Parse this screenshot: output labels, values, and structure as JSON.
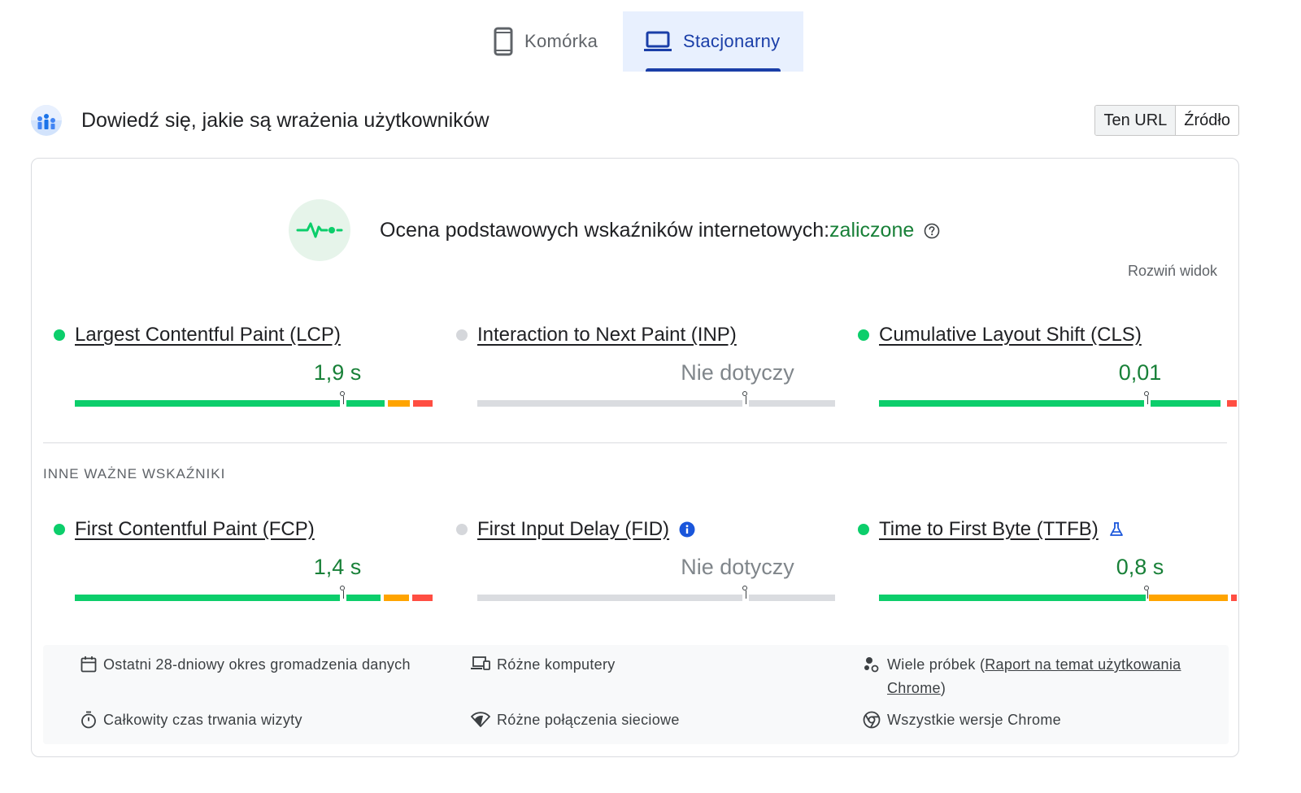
{
  "tabs": [
    {
      "label": "Komórka",
      "icon": "smartphone-icon",
      "active": false
    },
    {
      "label": "Stacjonarny",
      "icon": "laptop-icon",
      "active": true
    }
  ],
  "header": {
    "title": "Dowiedź się, jakie są wrażenia użytkowników",
    "toggle": {
      "url": "Ten URL",
      "origin": "Źródło",
      "active": "Ten URL"
    }
  },
  "assessment": {
    "label": "Ocena podstawowych wskaźników internetowych:",
    "result": "zaliczone",
    "expand": "Rozwiń widok"
  },
  "core_metrics": [
    {
      "name": "Largest Contentful Paint (LCP)",
      "status": "good",
      "value": "1,9 s",
      "distribution": {
        "good": 0.87,
        "needs_improvement": 0.07,
        "poor": 0.06
      },
      "marker": 0.75
    },
    {
      "name": "Interaction to Next Paint (INP)",
      "status": "na",
      "value": "Nie dotyczy",
      "marker": 0.75
    },
    {
      "name": "Cumulative Layout Shift (CLS)",
      "status": "good",
      "value": "0,01",
      "distribution": {
        "good": 0.96,
        "needs_improvement": 0.01,
        "poor": 0.03
      },
      "marker": 0.75
    }
  ],
  "other_section_label": "INNE WAŻNE WSKAŹNIKI",
  "other_metrics": [
    {
      "name": "First Contentful Paint (FCP)",
      "status": "good",
      "value": "1,4 s",
      "distribution": {
        "good": 0.86,
        "needs_improvement": 0.08,
        "poor": 0.06
      },
      "marker": 0.75
    },
    {
      "name": "First Input Delay (FID)",
      "status": "na",
      "value": "Nie dotyczy",
      "marker": 0.75,
      "extra_icon": "info-icon"
    },
    {
      "name": "Time to First Byte (TTFB)",
      "status": "good",
      "value": "0,8 s",
      "distribution": {
        "good": 0.75,
        "needs_improvement": 0.23,
        "poor": 0.02
      },
      "marker": 0.75,
      "extra_icon": "lab-flask-icon"
    }
  ],
  "info": {
    "period": "Ostatni 28-dniowy okres gromadzenia danych",
    "devices": "Różne komputery",
    "samples_prefix": "Wiele próbek (",
    "samples_link": "Raport na temat użytkowania Chrome",
    "samples_suffix": ")",
    "duration": "Całkowity czas trwania wizyty",
    "network": "Różne połączenia sieciowe",
    "chrome": "Wszystkie wersje Chrome"
  },
  "colors": {
    "good": "#0cce6b",
    "needs_improvement": "#ffa400",
    "poor": "#ff4e42",
    "accent": "#1a3ea8"
  }
}
